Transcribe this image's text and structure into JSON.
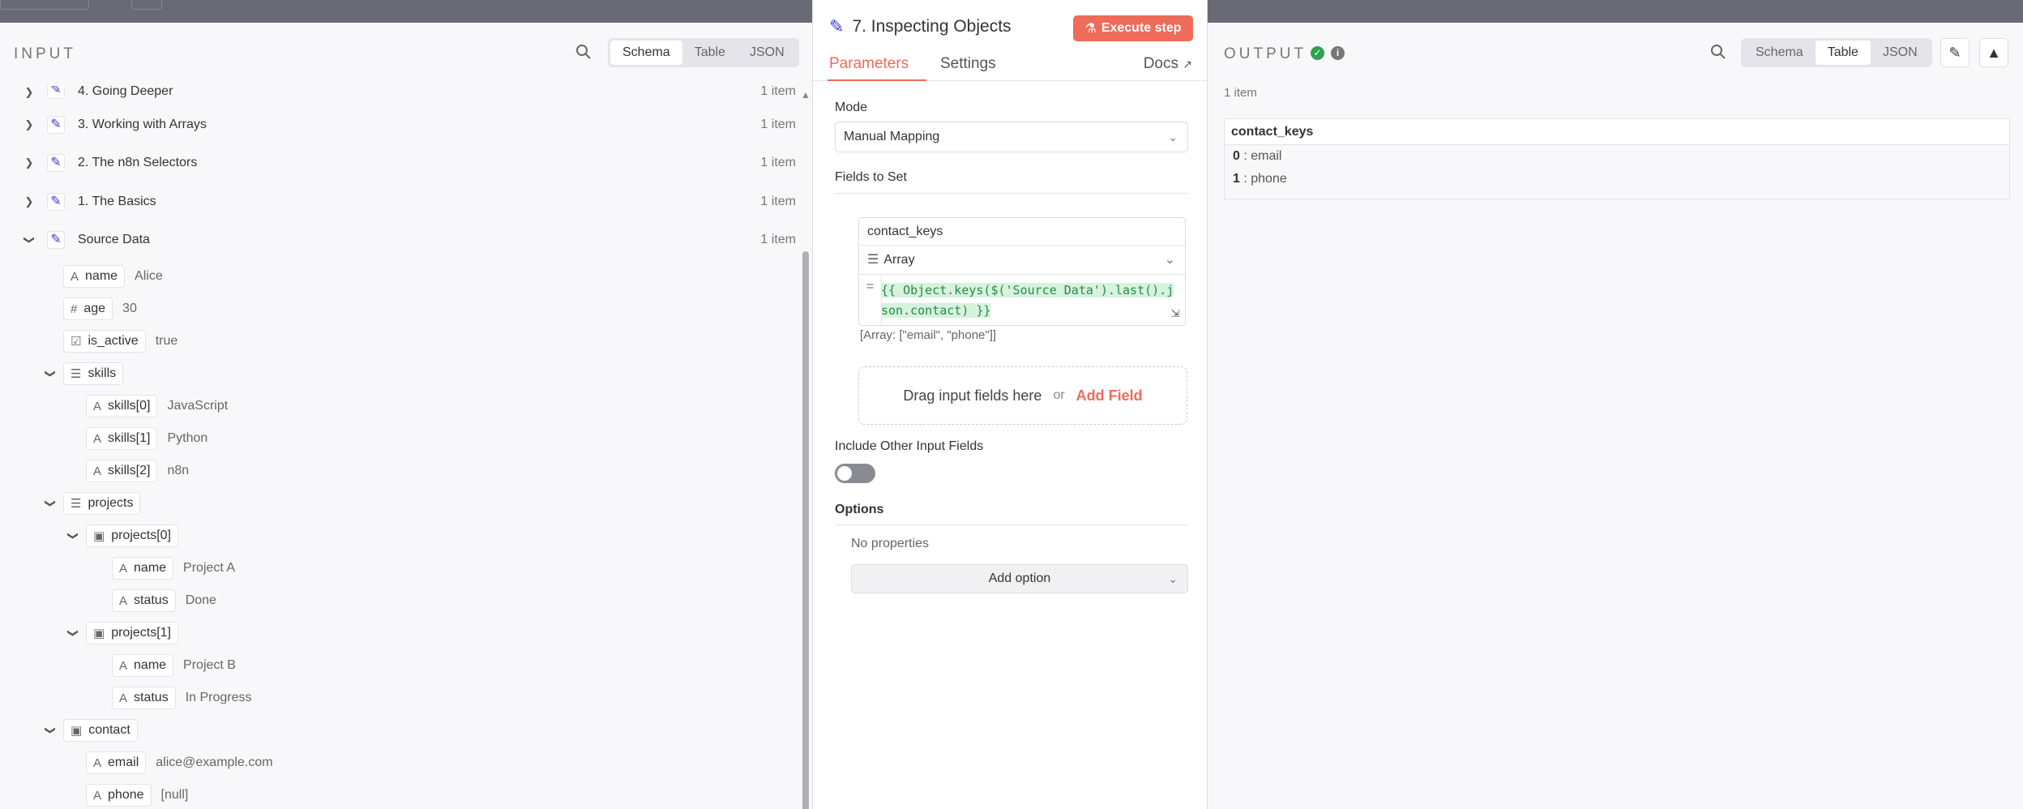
{
  "input": {
    "title": "INPUT",
    "views": [
      "Schema",
      "Table",
      "JSON"
    ],
    "active_view": "Schema",
    "nodes": [
      {
        "label": "4. Going Deeper",
        "count": "1 item"
      },
      {
        "label": "3. Working with Arrays",
        "count": "1 item"
      },
      {
        "label": "2. The n8n Selectors",
        "count": "1 item"
      },
      {
        "label": "1. The Basics",
        "count": "1 item"
      },
      {
        "label": "Source Data",
        "count": "1 item"
      }
    ],
    "fields": {
      "name": {
        "key": "name",
        "value": "Alice"
      },
      "age": {
        "key": "age",
        "value": "30"
      },
      "is_active": {
        "key": "is_active",
        "value": "true"
      },
      "skills": {
        "key": "skills"
      },
      "skills0": {
        "key": "skills[0]",
        "value": "JavaScript"
      },
      "skills1": {
        "key": "skills[1]",
        "value": "Python"
      },
      "skills2": {
        "key": "skills[2]",
        "value": "n8n"
      },
      "projects": {
        "key": "projects"
      },
      "projects0": {
        "key": "projects[0]"
      },
      "p0name": {
        "key": "name",
        "value": "Project A"
      },
      "p0status": {
        "key": "status",
        "value": "Done"
      },
      "projects1": {
        "key": "projects[1]"
      },
      "p1name": {
        "key": "name",
        "value": "Project B"
      },
      "p1status": {
        "key": "status",
        "value": "In Progress"
      },
      "contact": {
        "key": "contact"
      },
      "email": {
        "key": "email",
        "value": "alice@example.com"
      },
      "phone": {
        "key": "phone",
        "value": "[null]"
      }
    }
  },
  "node": {
    "title": "7. Inspecting Objects",
    "execute_label": "Execute step",
    "tabs": [
      "Parameters",
      "Settings"
    ],
    "docs_label": "Docs",
    "mode_label": "Mode",
    "mode_value": "Manual Mapping",
    "fields_label": "Fields to Set",
    "field_name": "contact_keys",
    "field_type": "Array",
    "expr_line1": "{{ Object.keys($('Source Data').last().j",
    "expr_line2": "son.contact) }}",
    "expr_result": "[Array: [\"email\", \"phone\"]]",
    "drag_text": "Drag input fields here",
    "or_text": "or",
    "add_field": "Add Field",
    "include_label": "Include Other Input Fields",
    "options_label": "Options",
    "no_props": "No properties",
    "add_option": "Add option"
  },
  "output": {
    "title": "OUTPUT",
    "views": [
      "Schema",
      "Table",
      "JSON"
    ],
    "active_view": "Table",
    "item_count": "1 item",
    "column": "contact_keys",
    "rows": [
      {
        "index": "0",
        "value": "email"
      },
      {
        "index": "1",
        "value": "phone"
      }
    ]
  },
  "colors": {
    "accent": "#ef6b5a",
    "node_icon": "#3b39d4",
    "success": "#2fa14f"
  }
}
